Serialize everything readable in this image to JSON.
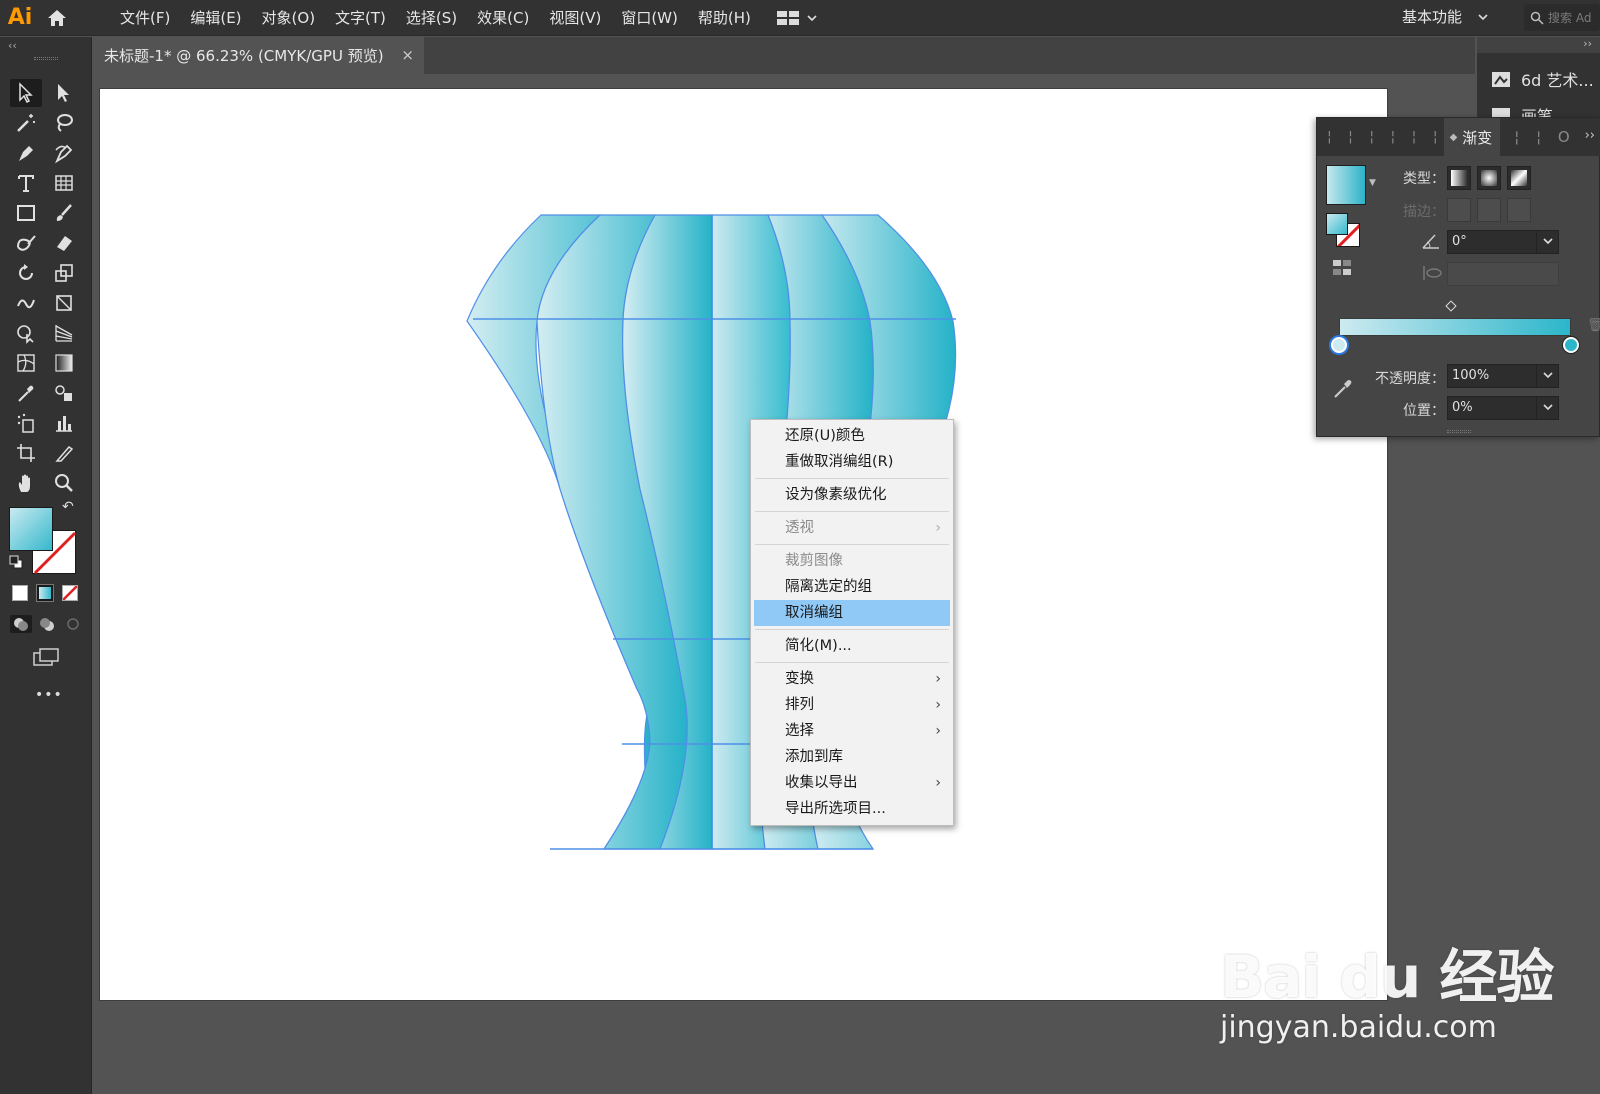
{
  "app": {
    "logo": "Ai"
  },
  "menubar": {
    "items": [
      "文件(F)",
      "编辑(E)",
      "对象(O)",
      "文字(T)",
      "选择(S)",
      "效果(C)",
      "视图(V)",
      "窗口(W)",
      "帮助(H)"
    ],
    "workspace": "基本功能",
    "search_placeholder": "搜索 Ad"
  },
  "document_tab": {
    "title": "未标题-1* @ 66.23% (CMYK/GPU 预览)",
    "close": "×"
  },
  "toolbar": {
    "more": "•••"
  },
  "context_menu": {
    "items": [
      {
        "label": "还原(U)颜色",
        "disabled": false,
        "submenu": false
      },
      {
        "label": "重做取消编组(R)",
        "disabled": false,
        "submenu": false
      },
      {
        "label": "设为像素级优化",
        "disabled": false,
        "submenu": false
      },
      {
        "label": "透视",
        "disabled": true,
        "submenu": true
      },
      {
        "label": "裁剪图像",
        "disabled": true,
        "submenu": false
      },
      {
        "label": "隔离选定的组",
        "disabled": false,
        "submenu": false
      },
      {
        "label": "取消编组",
        "disabled": false,
        "submenu": false,
        "highlighted": true
      },
      {
        "label": "简化(M)...",
        "disabled": false,
        "submenu": false
      },
      {
        "label": "变换",
        "disabled": false,
        "submenu": true
      },
      {
        "label": "排列",
        "disabled": false,
        "submenu": true
      },
      {
        "label": "选择",
        "disabled": false,
        "submenu": true
      },
      {
        "label": "添加到库",
        "disabled": false,
        "submenu": false
      },
      {
        "label": "收集以导出",
        "disabled": false,
        "submenu": true
      },
      {
        "label": "导出所选项目...",
        "disabled": false,
        "submenu": false
      }
    ],
    "arrow": "›"
  },
  "dock": {
    "collapse": "››",
    "items": [
      "6d 艺术...",
      "画笔"
    ]
  },
  "gradient_panel": {
    "tab_title": "渐变",
    "more": "››",
    "type_label": "类型：",
    "stroke_label": "描边：",
    "angle_value": "0°",
    "opacity_label": "不透明度：",
    "opacity_value": "100%",
    "location_label": "位置：",
    "location_value": "0%",
    "start_color": "#cdeaf0",
    "end_color": "#2bb6ca"
  },
  "watermark": {
    "brand": "Bai du 经验",
    "url": "jingyan.baidu.com"
  },
  "colors": {
    "accent_orange": "#ff9a00",
    "highlight_blue": "#90c8f6",
    "gradient_light": "#c7e8ee",
    "gradient_dark": "#2bb3c8"
  }
}
